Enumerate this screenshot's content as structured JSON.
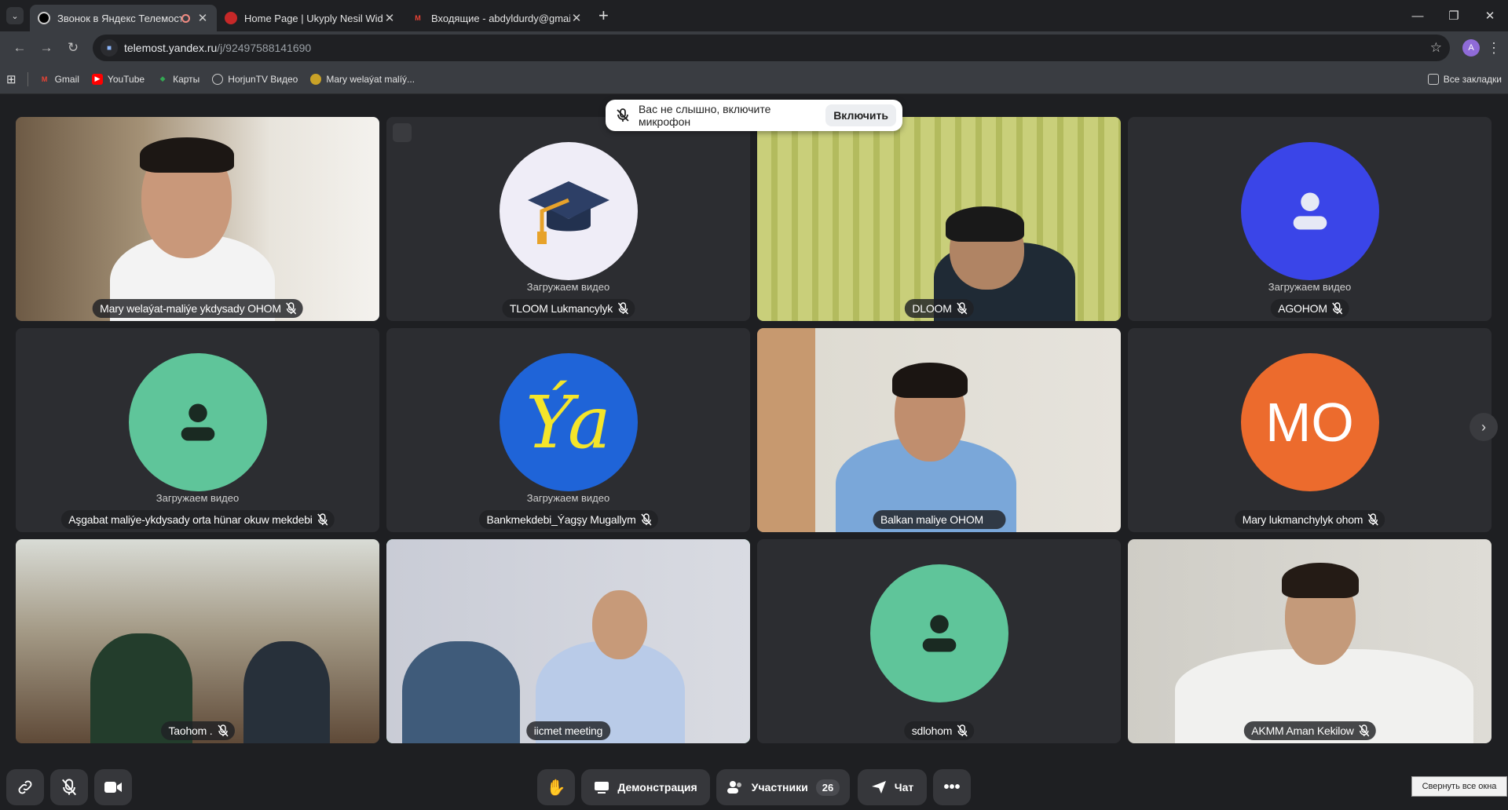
{
  "tabs": [
    {
      "title": "Звонок в Яндекс Телемост",
      "icon": "telemost-icon",
      "recording": true
    },
    {
      "title": "Home Page | Ukyply Nesil Wide",
      "icon": "site-icon"
    },
    {
      "title": "Входящие - abdyldurdy@gmail",
      "icon": "gmail-icon"
    }
  ],
  "address": {
    "host": "telemost.yandex.ru",
    "path": "/j/92497588141690",
    "profile_initial": "A"
  },
  "bookmarks": [
    {
      "label": "Gmail",
      "icon": "gmail-icon",
      "color": "#ea4335"
    },
    {
      "label": "YouTube",
      "icon": "youtube-icon",
      "color": "#ff0000"
    },
    {
      "label": "Карты",
      "icon": "maps-icon",
      "color": "#34a853"
    },
    {
      "label": "HorjunTV Видео",
      "icon": "globe-icon",
      "color": "#cccccc"
    },
    {
      "label": "Mary welaýat malíý...",
      "icon": "emblem-icon",
      "color": "#c9a227"
    }
  ],
  "all_bookmarks": "Все закладки",
  "toast": {
    "text": "Вас не слышно, включите микрофон",
    "button": "Включить"
  },
  "loading_text": "Загружаем видео",
  "participants": [
    {
      "name": "Mary welaýat-maliýe ykdysady OHOM",
      "type": "video",
      "bg": "#9c8a72"
    },
    {
      "name": "TLOOM Lukmancylyk",
      "type": "avatar",
      "avatar": "graduation-cap-icon",
      "avatar_bg": "#efedf7",
      "loading": true
    },
    {
      "name": "DLOOM",
      "type": "video",
      "bg": "#a8b060"
    },
    {
      "name": "AGOHOM",
      "type": "avatar",
      "avatar": "user-icon",
      "avatar_bg": "#3a45e8",
      "loading": true
    },
    {
      "name": "Aşgabat maliýe-ykdysady orta hünar okuw mekdebi",
      "type": "avatar",
      "avatar": "user-icon",
      "avatar_bg": "#5fc59a",
      "loading": true
    },
    {
      "name": "Bankmekdebi_Ýagşy Mugallym",
      "type": "avatar",
      "avatar": "ya-logo",
      "avatar_bg": "#1f64d8",
      "avatar_text": "Ýa",
      "loading": true
    },
    {
      "name": "Balkan maliye OHOM",
      "type": "video",
      "bg": "#b9b5a8"
    },
    {
      "name": "Mary lukmanchylyk ohom",
      "type": "avatar",
      "avatar": "initials",
      "avatar_bg": "#ec6b2d",
      "avatar_text": "MO"
    },
    {
      "name": "Taohom .",
      "type": "video",
      "bg": "#6e6a5c"
    },
    {
      "name": "iicmet meeting",
      "type": "video",
      "bg": "#c7cbd6",
      "speaking": true
    },
    {
      "name": "sdlohom",
      "type": "avatar",
      "avatar": "user-icon",
      "avatar_bg": "#5fc59a"
    },
    {
      "name": "AKMM Aman Kekilow",
      "type": "video",
      "bg": "#d3d2cd"
    }
  ],
  "controls": {
    "demo": "Демонстрация",
    "participants": "Участники",
    "participants_count": "26",
    "chat": "Чат"
  },
  "tooltip": "Свернуть все окна"
}
